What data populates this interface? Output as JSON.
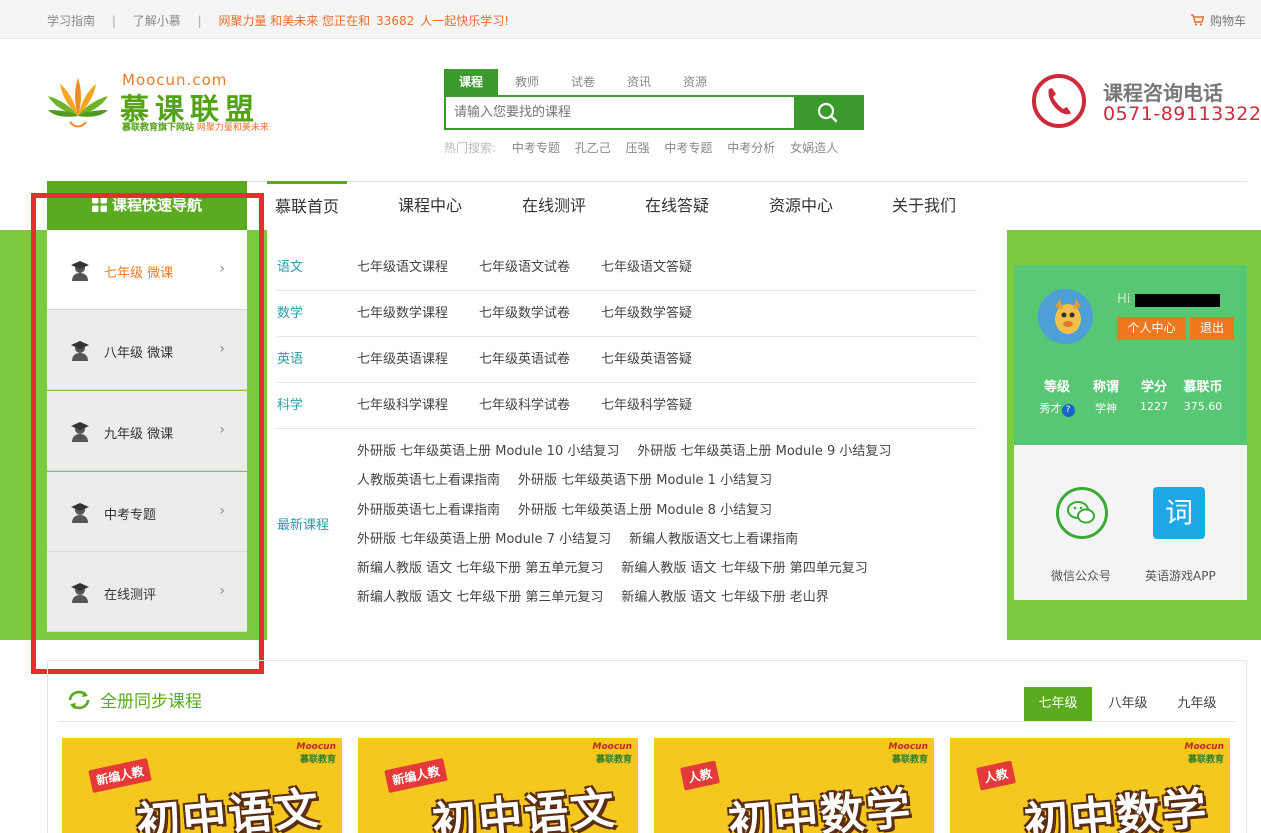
{
  "topbar": {
    "links": [
      "学习指南",
      "了解小慕"
    ],
    "separator": "|",
    "promo_prefix": "网聚力量  和美未来  您正在和",
    "online_count": "33682",
    "promo_suffix": "人一起快乐学习!",
    "cart_label": "购物车"
  },
  "logo": {
    "en": "Moocun.com",
    "cn": "慕课联盟",
    "slogan_a": "慕联教育旗下网站",
    "slogan_b": "网聚力量和美未来"
  },
  "search": {
    "tabs": [
      "课程",
      "教师",
      "试卷",
      "资讯",
      "资源"
    ],
    "active_tab": "课程",
    "placeholder": "请输入您要找的课程",
    "hot_label": "热门搜索:",
    "hot_keywords": [
      "中考专题",
      "孔乙己",
      "压强",
      "中考专题",
      "中考分析",
      "女娲造人"
    ]
  },
  "phone": {
    "label": "课程咨询电话",
    "number": "0571-89113322"
  },
  "nav": {
    "quick_title": "课程快速导航",
    "items": [
      "慕联首页",
      "课程中心",
      "在线测评",
      "在线答疑",
      "资源中心",
      "关于我们"
    ]
  },
  "left_menu": [
    {
      "label": "七年级 微课",
      "active": true
    },
    {
      "label": "八年级 微课",
      "active": false
    },
    {
      "label": "九年级 微课",
      "active": false
    },
    {
      "label": "中考专题",
      "active": false
    },
    {
      "label": "在线测评",
      "active": false
    }
  ],
  "subjects": [
    {
      "name": "语文",
      "links": [
        "七年级语文课程",
        "七年级语文试卷",
        "七年级语文答疑"
      ]
    },
    {
      "name": "数学",
      "links": [
        "七年级数学课程",
        "七年级数学试卷",
        "七年级数学答疑"
      ]
    },
    {
      "name": "英语",
      "links": [
        "七年级英语课程",
        "七年级英语试卷",
        "七年级英语答疑"
      ]
    },
    {
      "name": "科学",
      "links": [
        "七年级科学课程",
        "七年级科学试卷",
        "七年级科学答疑"
      ]
    }
  ],
  "latest": {
    "label": "最新课程",
    "rows": [
      [
        "外研版 七年级英语上册 Module 10 小结复习",
        "外研版 七年级英语上册 Module 9 小结复习"
      ],
      [
        "人教版英语七上看课指南",
        "外研版 七年级英语下册 Module 1 小结复习"
      ],
      [
        "外研版英语七上看课指南",
        "外研版 七年级英语上册 Module 8 小结复习"
      ],
      [
        "外研版 七年级英语上册 Module 7 小结复习",
        "新编人教版语文七上看课指南"
      ],
      [
        "新编人教版 语文 七年级下册 第五单元复习",
        "新编人教版 语文 七年级下册 第四单元复习"
      ],
      [
        "新编人教版 语文 七年级下册 第三单元复习",
        "新编人教版 语文 七年级下册 老山界"
      ]
    ]
  },
  "user": {
    "greeting": "Hi",
    "btn_center": "个人中心",
    "btn_logout": "退出",
    "stats": [
      {
        "key": "等级",
        "value": "秀才"
      },
      {
        "key": "称谓",
        "value": "学神"
      },
      {
        "key": "学分",
        "value": "1227"
      },
      {
        "key": "慕联币",
        "value": "375.60"
      }
    ],
    "help_mark": "?",
    "wechat_label": "微信公众号",
    "app_label": "英语游戏APP",
    "app_glyph": "词"
  },
  "section": {
    "title": "全册同步课程",
    "grades": [
      "七年级",
      "八年级",
      "九年级"
    ],
    "active_grade": "七年级",
    "cards": [
      {
        "tag": "新编人教",
        "title": "初中语文",
        "brand_en": "Moocun",
        "brand_cn": "慕联教育"
      },
      {
        "tag": "新编人教",
        "title": "初中语文",
        "brand_en": "Moocun",
        "brand_cn": "慕联教育"
      },
      {
        "tag": "人教",
        "title": "初中数学",
        "brand_en": "Moocun",
        "brand_cn": "慕联教育"
      },
      {
        "tag": "人教",
        "title": "初中数学",
        "brand_en": "Moocun",
        "brand_cn": "慕联教育"
      }
    ]
  },
  "colors": {
    "brand_green": "#5aab20",
    "band_green": "#7ccb3e",
    "accent_orange": "#ee6d2b",
    "phone_red": "#cd2b3a",
    "highlight_red": "#e92d2d"
  }
}
